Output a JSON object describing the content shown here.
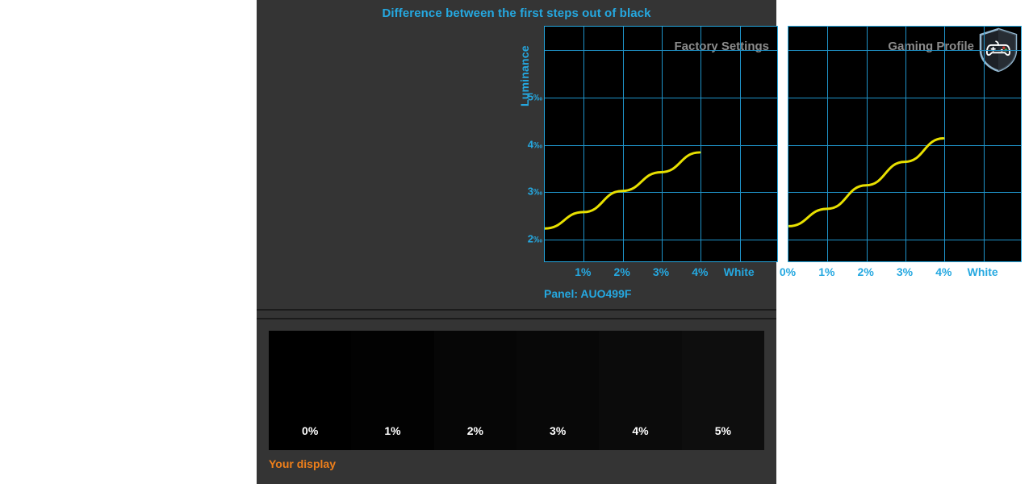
{
  "chart_data": {
    "type": "line",
    "title": "Difference between the first steps out of black",
    "ylabel": "Luminance",
    "xlabel": "",
    "ylim": [
      1.5,
      6.5
    ],
    "grid": true,
    "y_ticks": [
      "5",
      "4",
      "3",
      "2"
    ],
    "y_tick_unit": "‰",
    "y_tick_values": [
      5,
      4,
      3,
      2
    ],
    "panels": [
      {
        "name": "Factory Settings",
        "x_tick_labels": [
          "0%",
          "1%",
          "2%",
          "3%",
          "4%",
          "White"
        ],
        "x_tick_visible": [
          false,
          true,
          true,
          true,
          true,
          true
        ],
        "series": [
          {
            "name": "Factory Settings",
            "color": "#e8e000",
            "x": [
              0,
              1,
              2,
              3,
              4
            ],
            "values": [
              2.2,
              2.55,
              3.0,
              3.4,
              3.82
            ]
          }
        ]
      },
      {
        "name": "Gaming Profile",
        "x_tick_labels": [
          "0%",
          "1%",
          "2%",
          "3%",
          "4%",
          "White"
        ],
        "x_tick_visible": [
          true,
          true,
          true,
          true,
          true,
          true
        ],
        "series": [
          {
            "name": "Gaming Profile",
            "color": "#e8e000",
            "x": [
              0,
              1,
              2,
              3,
              4
            ],
            "values": [
              2.25,
              2.62,
              3.12,
              3.62,
              4.12
            ]
          }
        ]
      }
    ]
  },
  "header": {
    "title": "Difference between the first steps out of black"
  },
  "axes": {
    "y_label": "Luminance",
    "y_ticks": [
      {
        "value": "5",
        "unit": "‰"
      },
      {
        "value": "4",
        "unit": "‰"
      },
      {
        "value": "3",
        "unit": "‰"
      },
      {
        "value": "2",
        "unit": "‰"
      }
    ]
  },
  "left_chart": {
    "label": "Factory Settings",
    "x_ticks": [
      "1%",
      "2%",
      "3%",
      "4%",
      "White"
    ]
  },
  "right_chart": {
    "label": "Gaming Profile",
    "x_ticks": [
      "0%",
      "1%",
      "2%",
      "3%",
      "4%",
      "White"
    ],
    "badge_icon": "gamepad-shield-icon"
  },
  "footer": {
    "panel_info": "Panel: AUO499F"
  },
  "gradient_strip": {
    "caption": "Your display",
    "patches": [
      {
        "label": "0%",
        "color": "#000000"
      },
      {
        "label": "1%",
        "color": "#020202"
      },
      {
        "label": "2%",
        "color": "#060606"
      },
      {
        "label": "3%",
        "color": "#080808"
      },
      {
        "label": "4%",
        "color": "#0b0b0b"
      },
      {
        "label": "5%",
        "color": "#0e0e0e"
      }
    ]
  },
  "colors": {
    "accent_cyan": "#25a8e0",
    "curve_yellow": "#e8e000",
    "orange": "#ef7f1a",
    "panel_bg": "#343434",
    "plot_bg": "#000000",
    "label_gray": "#8c8c8c"
  }
}
